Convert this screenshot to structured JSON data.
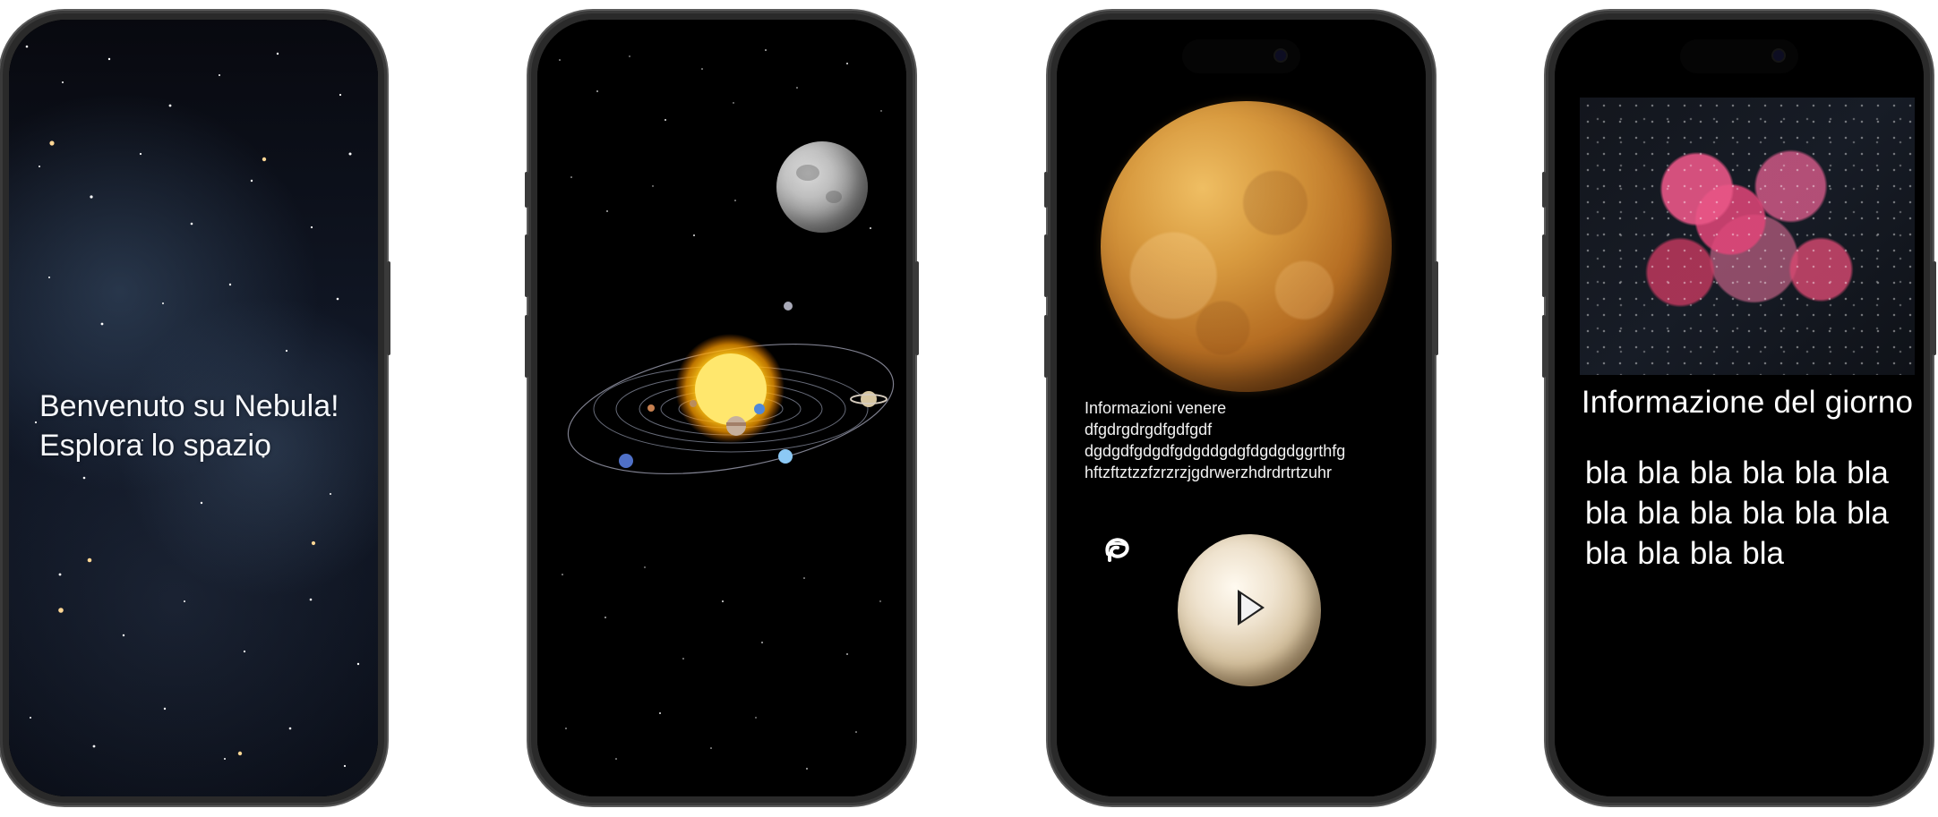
{
  "screens": {
    "welcome": {
      "line1": "Benvenuto su Nebula!",
      "line2": "Esplora lo spazio"
    },
    "venus": {
      "title": "Informazioni venere",
      "line1": "dfgdrgdrgdfgdfgdf",
      "line2": "dgdgdfgdgdfgdgddgdgfdgdgdggrthfg",
      "line3": "hftzftztzzfzrzrzjgdrwerzhdrdrtrtzuhr"
    },
    "daily": {
      "title": "Informazione del giorno",
      "line1": "bla bla bla bla bla bla",
      "line2": "bla bla bla bla bla bla",
      "line3": "bla bla bla bla"
    }
  },
  "colors": {
    "frame": "#2a2a2a",
    "screen": "#000000",
    "text": "#ffffff",
    "venus": "#c77b2f",
    "nebula": "#e25a8d"
  },
  "icons": {
    "astronaut": "astronaut-icon",
    "play": "play-icon"
  }
}
